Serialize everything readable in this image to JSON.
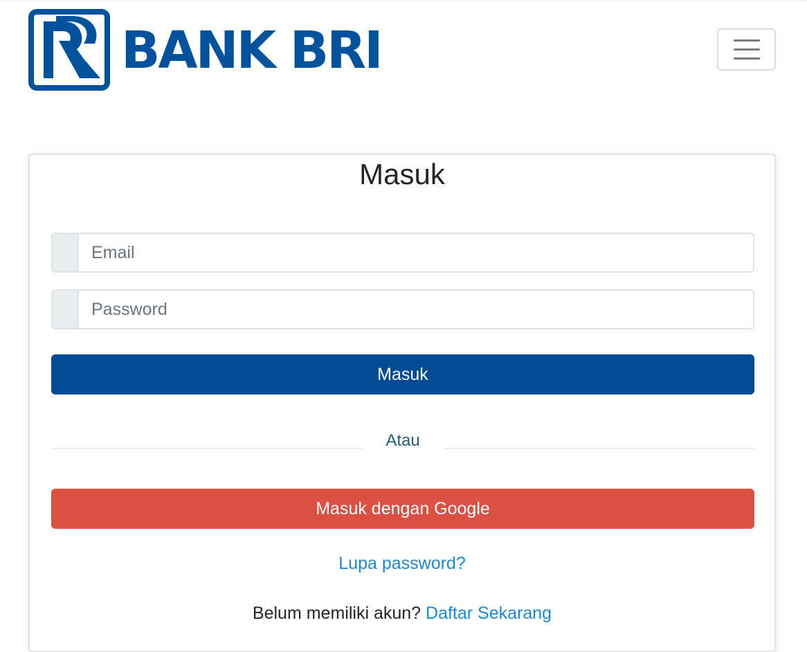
{
  "brand": {
    "name": "BANK BRI",
    "color": "#00529c"
  },
  "navbar": {
    "menu_icon": "hamburger-menu-icon"
  },
  "login": {
    "title": "Masuk",
    "email_placeholder": "Email",
    "password_placeholder": "Password",
    "submit_label": "Masuk",
    "divider_text": "Atau",
    "google_label": "Masuk dengan Google",
    "forgot_label": "Lupa password?",
    "signup_prompt": "Belum memiliki akun?",
    "signup_link": "Daftar Sekarang"
  },
  "colors": {
    "primary_button": "#034c93",
    "google_button": "#dd5145",
    "link": "#1e88d6"
  }
}
